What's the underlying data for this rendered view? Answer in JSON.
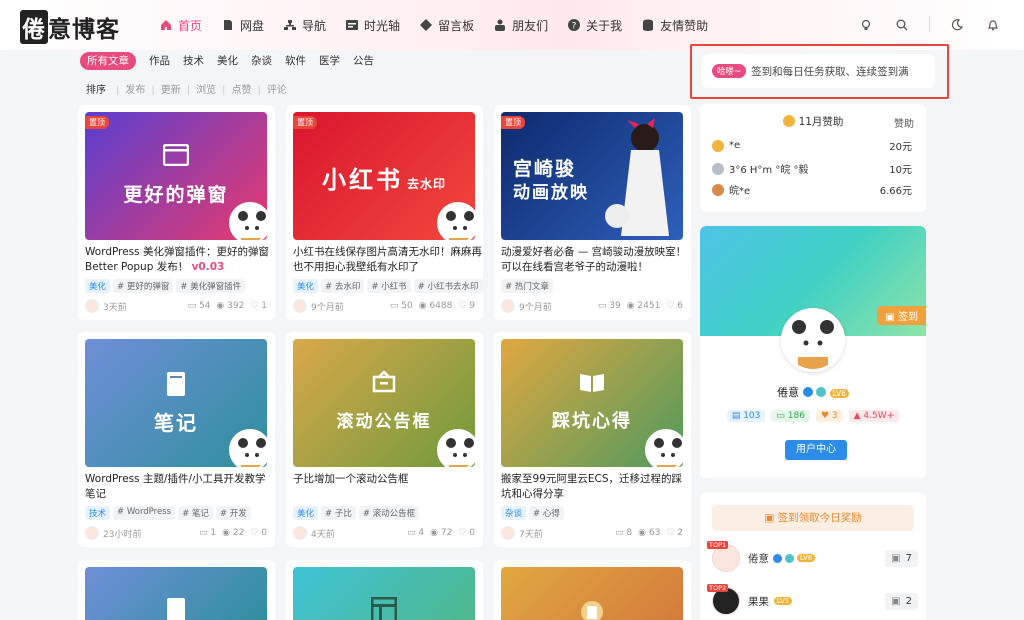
{
  "header": {
    "logo": [
      "倦",
      "意",
      "博",
      "客"
    ],
    "nav": [
      {
        "label": "首页",
        "icon": "home-icon",
        "active": true
      },
      {
        "label": "网盘",
        "icon": "file-icon"
      },
      {
        "label": "导航",
        "icon": "sitemap-icon"
      },
      {
        "label": "时光轴",
        "icon": "timeline-icon"
      },
      {
        "label": "留言板",
        "icon": "tag-icon"
      },
      {
        "label": "朋友们",
        "icon": "users-icon"
      },
      {
        "label": "关于我",
        "icon": "question-icon"
      },
      {
        "label": "友情赞助",
        "icon": "database-icon"
      }
    ]
  },
  "tabs": [
    "所有文章",
    "作品",
    "技术",
    "美化",
    "杂谈",
    "软件",
    "医学",
    "公告"
  ],
  "sort": {
    "label": "排序",
    "options": [
      "发布",
      "更新",
      "浏览",
      "点赞",
      "评论"
    ]
  },
  "posts": [
    {
      "badge": "置顶",
      "thumb_title": "更好的弹窗",
      "colors": [
        "#5a3fd1",
        "#e83a6c"
      ],
      "title": "WordPress 美化弹窗插件：更好的弹窗 Better Popup 发布！",
      "version": "v0.03",
      "tags": [
        "美化",
        "# 更好的弹窗",
        "# 美化弹窗插件"
      ],
      "time": "3天前",
      "comments": "54",
      "views": "392",
      "likes": "1"
    },
    {
      "badge": "置顶",
      "thumb_title": "小红书",
      "thumb_sub": "去水印",
      "colors": [
        "#d9162e",
        "#f2473d"
      ],
      "title": "小红书在线保存图片高清无水印！麻麻再也不用担心我壁纸有水印了",
      "tags": [
        "美化",
        "# 去水印",
        "# 小红书",
        "# 小红书去水印"
      ],
      "time": "9个月前",
      "comments": "50",
      "views": "6488",
      "likes": "9"
    },
    {
      "badge": "置顶",
      "thumb_title": "宫崎骏",
      "thumb_sub": "动画放映",
      "colors": [
        "#0d2a6d",
        "#2f5fbb"
      ],
      "title": "动漫爱好者必备 — 宫崎骏动漫放映室！可以在线看宫老爷子的动漫啦！",
      "tags": [
        "# 热门文章"
      ],
      "time": "9个月前",
      "comments": "39",
      "views": "2451",
      "likes": "6"
    },
    {
      "thumb_title": "笔记",
      "colors": [
        "#6f8fd8",
        "#2e8f9d"
      ],
      "title": "WordPress 主题/插件/小工具开发教学笔记",
      "tags": [
        "技术",
        "# WordPress",
        "# 笔记",
        "# 开发"
      ],
      "time": "23小时前",
      "comments": "1",
      "views": "22",
      "likes": "0"
    },
    {
      "thumb_title": "滚动公告框",
      "colors": [
        "#d9a84a",
        "#6f9a3c"
      ],
      "title": "子比增加一个滚动公告框",
      "tags": [
        "美化",
        "# 子比",
        "# 滚动公告框"
      ],
      "time": "4天前",
      "comments": "4",
      "views": "72",
      "likes": "0"
    },
    {
      "thumb_title": "踩坑心得",
      "colors": [
        "#e0a840",
        "#4f9a5d"
      ],
      "title": "搬家至99元阿里云ECS，迁移过程的踩坑和心得分享",
      "tags": [
        "杂谈",
        "# 心得"
      ],
      "time": "7天前",
      "comments": "8",
      "views": "63",
      "likes": "2"
    },
    {
      "colors": [
        "#6f8fd8",
        "#2e8f9d"
      ]
    },
    {
      "colors": [
        "#3fc3d8",
        "#4fb88a"
      ]
    },
    {
      "colors": [
        "#e0a840",
        "#d47a3c"
      ]
    }
  ],
  "notice": {
    "badge": "哈喽~",
    "text": "签到和每日任务获取、连续签到满"
  },
  "donate": {
    "title": "11月赞助",
    "link": "赞助",
    "rows": [
      {
        "name": "*e",
        "amount": "20元",
        "color": "#f0b43c"
      },
      {
        "name": "3°6 H°m °皖 °毅",
        "amount": "10元",
        "color": "#b8bcc4"
      },
      {
        "name": "皖*e",
        "amount": "6.66元",
        "color": "#d88a4a"
      }
    ]
  },
  "profile": {
    "signin": "签到",
    "name": "倦意",
    "level": "LV6",
    "stats": [
      "103",
      "186",
      "3",
      "4.5W+"
    ],
    "center_btn": "用户中心"
  },
  "checkin": {
    "banner": "签到领取今日奖励",
    "ranks": [
      {
        "top": "TOP1",
        "name": "倦意",
        "level": "LV6",
        "count": "7"
      },
      {
        "top": "TOP2",
        "name": "果果",
        "level": "LV1",
        "count": "2"
      }
    ]
  },
  "theme_colors": {
    "accent": "#e84b7e",
    "brand_blue": "#2d8ce8"
  }
}
